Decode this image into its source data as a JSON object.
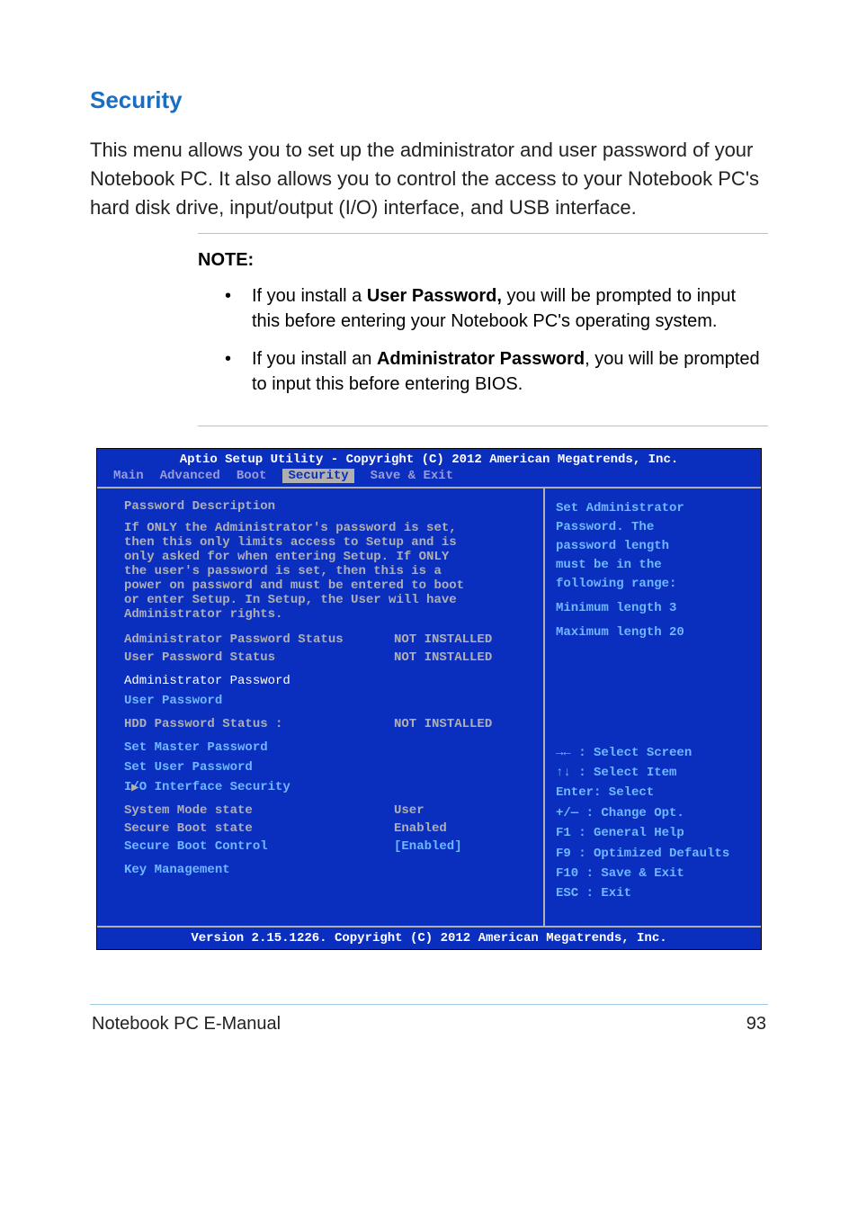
{
  "heading": "Security",
  "body": "This menu allows you to set up the administrator and user password of your Notebook PC. It also allows you to control the access to your Notebook PC's hard disk drive, input/output (I/O) interface, and USB interface.",
  "note": {
    "label": "NOTE:",
    "b1_pre": "If you install a ",
    "b1_bold": "User Password,",
    "b1_post": " you will be prompted to input this before entering your Notebook PC's operating system.",
    "b2_pre": "If you install an ",
    "b2_bold": "Administrator Password",
    "b2_post": ", you will be prompted to input this before entering BIOS."
  },
  "bios": {
    "top": "Aptio Setup Utility - Copyright (C) 2012 American Megatrends, Inc.",
    "tabs": {
      "main": "Main",
      "advanced": "Advanced",
      "boot": "Boot",
      "security": "Security",
      "save": "Save & Exit"
    },
    "left": {
      "h": "Password Description",
      "desc1": "If ONLY the Administrator's password is set,",
      "desc2": "then this only limits access to Setup and is",
      "desc3": "only asked for when entering Setup. If ONLY",
      "desc4": "the user's password is set, then this is a",
      "desc5": "power on password and must be entered to boot",
      "desc6": "or enter Setup. In Setup, the User will have",
      "desc7": "Administrator rights.",
      "admin_status_k": "Administrator Password Status",
      "admin_status_v": "NOT INSTALLED",
      "user_status_k": "User Password Status",
      "user_status_v": "NOT INSTALLED",
      "admin_pw": "Administrator Password",
      "user_pw": "User Password",
      "hdd_k": "HDD Password Status :",
      "hdd_v": "NOT INSTALLED",
      "set_master": "Set Master Password",
      "set_user": "Set User Password",
      "io": "I/O Interface Security",
      "sysmode_k": "System Mode state",
      "sysmode_v": "User",
      "secboot_k": "Secure Boot state",
      "secboot_v": "Enabled",
      "secctrl_k": "Secure Boot Control",
      "secctrl_v": "[Enabled]",
      "keymgmt": "Key Management"
    },
    "right_top": {
      "l1": "Set Administrator",
      "l2": "Password. The",
      "l3": "password length",
      "l4": "must be in the",
      "l5": "following range:",
      "l6": "Minimum length 3",
      "l7": "Maximum length 20"
    },
    "right_bottom": {
      "l1": "→←  : Select Screen",
      "l2": "↑↓   : Select Item",
      "l3": "Enter: Select",
      "l4": "+/—  : Change Opt.",
      "l5": "F1   : General Help",
      "l6": "F9   : Optimized Defaults",
      "l7": "F10  : Save & Exit",
      "l8": "ESC  : Exit"
    },
    "bottom": "Version 2.15.1226. Copyright (C) 2012 American Megatrends, Inc."
  },
  "footer": {
    "left": "Notebook PC E-Manual",
    "right": "93"
  }
}
